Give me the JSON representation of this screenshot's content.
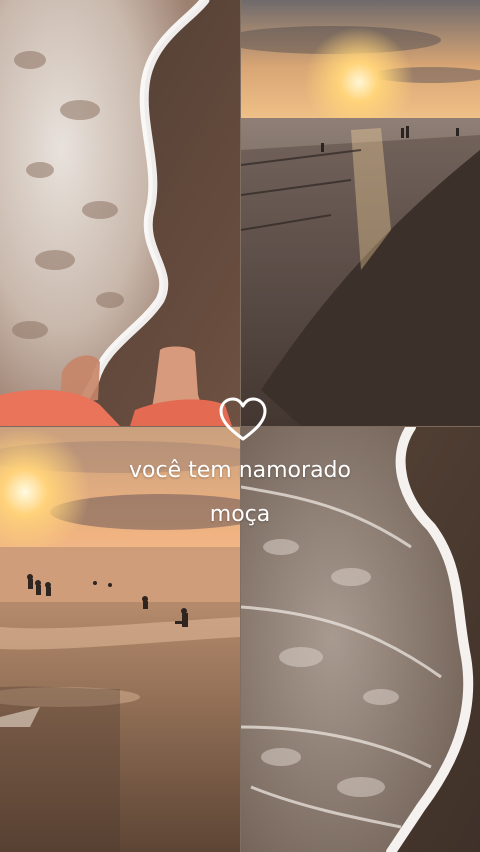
{
  "caption": {
    "line1": "você tem namorado",
    "line2": "moça"
  },
  "photos": [
    {
      "name": "feet-in-foam",
      "dominant_color": "#8a6a55"
    },
    {
      "name": "sunset-shoreline",
      "dominant_color": "#b08060"
    },
    {
      "name": "sunset-swimmers",
      "dominant_color": "#c8926a"
    },
    {
      "name": "foam-wave-closeup",
      "dominant_color": "#6e5a4c"
    }
  ],
  "icons": {
    "heart": "heart-outline-icon"
  },
  "colors": {
    "text": "#ffffff",
    "sand": "#6a4f3e",
    "sun": "#ffd27a"
  }
}
